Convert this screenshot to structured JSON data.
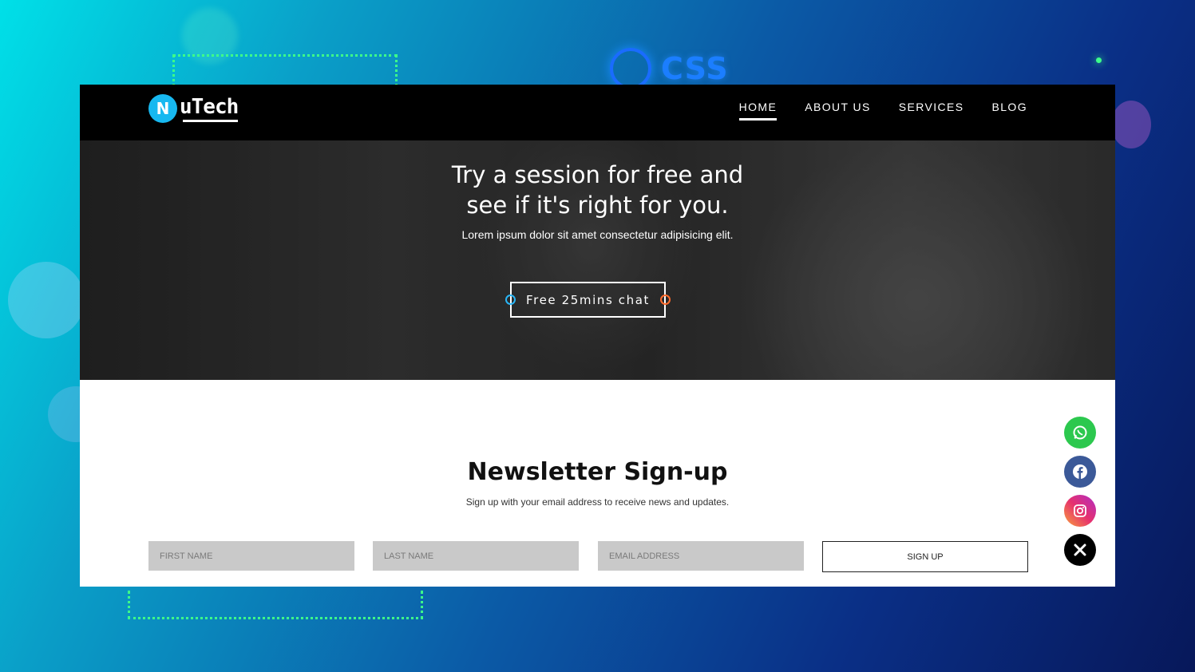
{
  "background": {
    "css_logo_text": "CSS"
  },
  "brand": {
    "logo_letter": "N",
    "name": "uTech"
  },
  "nav": {
    "items": [
      {
        "label": "HOME",
        "active": true
      },
      {
        "label": "ABOUT US",
        "active": false
      },
      {
        "label": "SERVICES",
        "active": false
      },
      {
        "label": "BLOG",
        "active": false
      }
    ]
  },
  "hero": {
    "title": "Try a session for free and see if it's right for you.",
    "subtitle": "Lorem ipsum dolor sit amet consectetur adipisicing elit.",
    "cta_label": "Free 25mins chat"
  },
  "newsletter": {
    "title": "Newsletter Sign-up",
    "subtitle": "Sign up with your email address to receive news and updates.",
    "first_name_placeholder": "FIRST NAME",
    "last_name_placeholder": "LAST NAME",
    "email_placeholder": "EMAIL ADDRESS",
    "submit_label": "SIGN UP"
  },
  "social": {
    "icons": [
      "whatsapp-icon",
      "facebook-icon",
      "instagram-icon",
      "close-icon"
    ],
    "colors": {
      "whatsapp": "#2cc84e",
      "facebook": "#3b5998",
      "close": "#000000"
    }
  }
}
